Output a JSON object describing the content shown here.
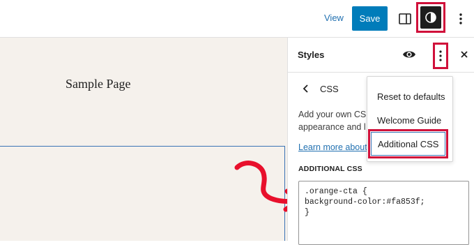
{
  "toolbar": {
    "view_label": "View",
    "save_label": "Save",
    "icons": [
      "sidebar-toggle-icon",
      "contrast-icon",
      "more-vertical-icon"
    ]
  },
  "canvas": {
    "page_title": "Sample Page"
  },
  "sidebar": {
    "title": "Styles",
    "nav_title": "CSS",
    "description_lines": [
      "Add your own CS",
      "appearance and l"
    ],
    "learn_more": "Learn more about",
    "section_label": "ADDITIONAL CSS",
    "css_code": ".orange-cta {\nbackground-color:#fa853f;\n}"
  },
  "menu": {
    "items": [
      "Reset to defaults",
      "Welcome Guide",
      "Additional CSS"
    ]
  },
  "colors": {
    "accent": "#007cba",
    "highlight": "#d0103a",
    "canvas_bg": "#f5f1ec"
  }
}
